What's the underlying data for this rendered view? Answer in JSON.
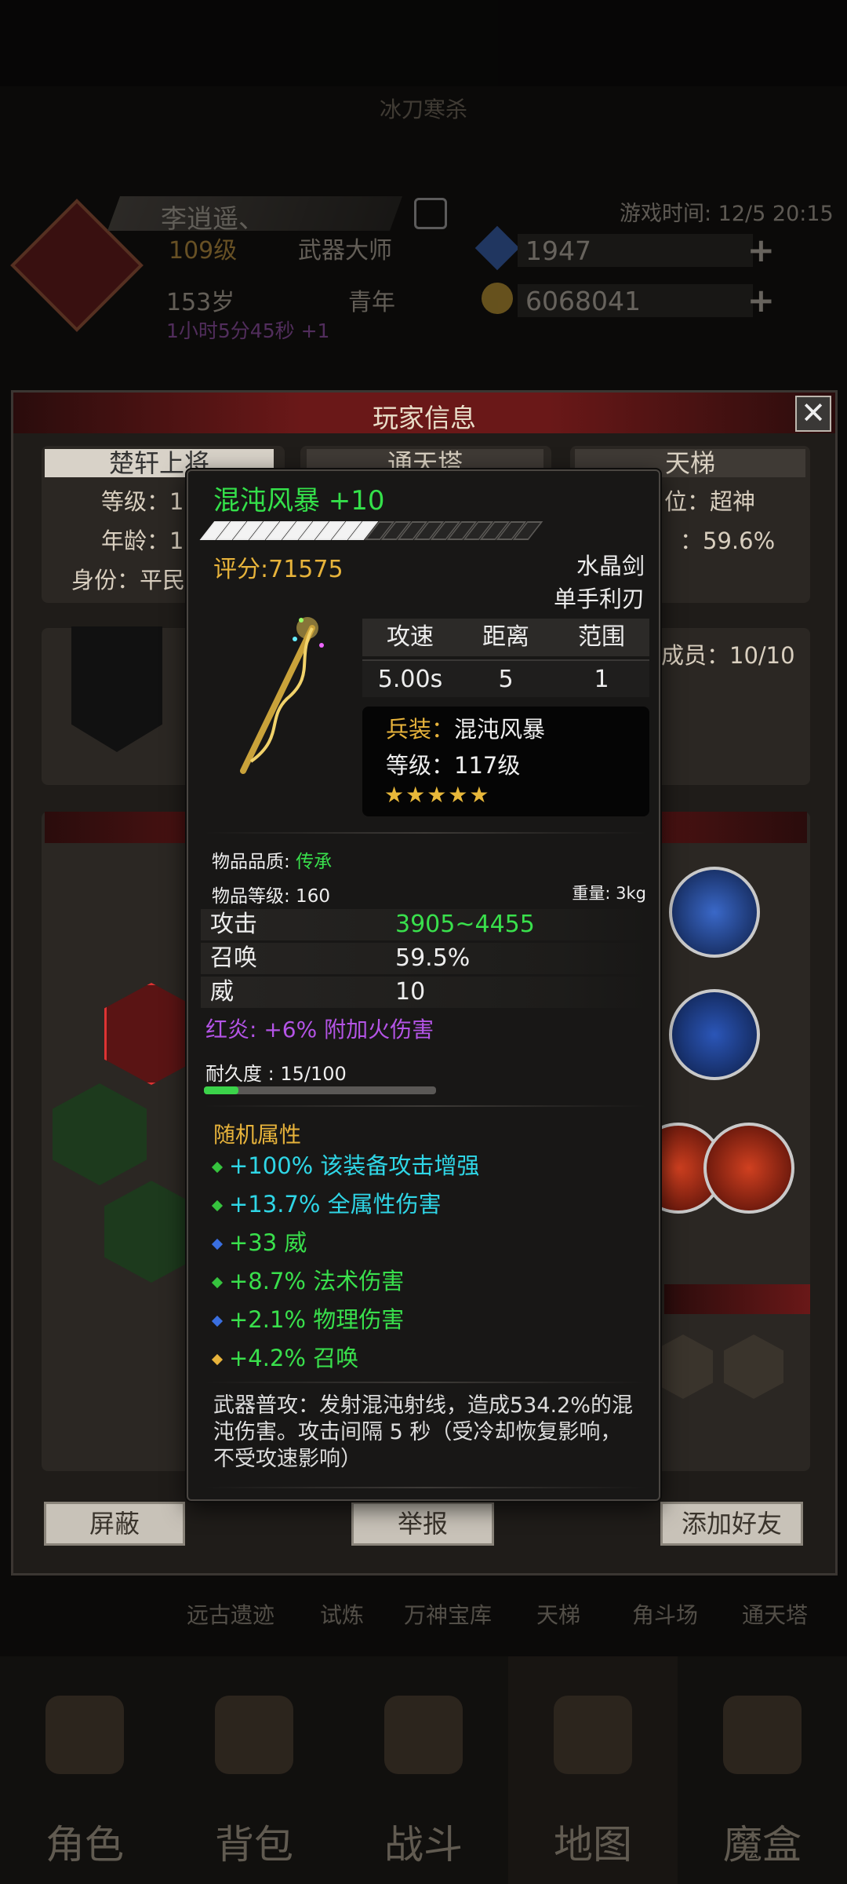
{
  "background": {
    "header_title": "冰刀寒杀",
    "player": {
      "name": "李逍遥、",
      "level": "109级",
      "class": "武器大师",
      "age": "153岁",
      "age_stage": "青年",
      "timer": "1小时5分45秒 +1"
    },
    "game_time": "游戏时间: 12/5 20:15",
    "resources": [
      {
        "icon": "blue-gem-icon",
        "value": "1947"
      },
      {
        "icon": "gold-coin-icon",
        "value": "6068041"
      }
    ],
    "nav_links": [
      "远古遗迹",
      "试炼",
      "万神宝库",
      "天梯",
      "角斗场",
      "通天塔"
    ],
    "tabs": [
      {
        "label": "角色",
        "icon": "helmet-icon"
      },
      {
        "label": "背包",
        "icon": "backpack-icon"
      },
      {
        "label": "战斗",
        "icon": "sword-shield-icon"
      },
      {
        "label": "地图",
        "icon": "scroll-map-icon",
        "active": true
      },
      {
        "label": "魔盒",
        "icon": "magic-box-icon"
      }
    ]
  },
  "dialog": {
    "title": "玩家信息",
    "tabs": [
      "楚轩上将",
      "通天塔",
      "天梯"
    ],
    "left_info": [
      "等级：1",
      "年龄：1",
      "身份：平民"
    ],
    "right_info": [
      "位：超神",
      "：59.6%"
    ],
    "guild_members": "成员：10/10",
    "buttons": {
      "block": "屏蔽",
      "report": "举报",
      "add_friend": "添加好友"
    }
  },
  "tooltip": {
    "name": "混沌风暴 +10",
    "name_color": "#34e04a",
    "enhance_level": 10,
    "enhance_max": 20,
    "score": "评分:71575",
    "weapon_type": "水晶剑",
    "weapon_sub": "单手利刃",
    "stat_headers": [
      "攻速",
      "距离",
      "范围"
    ],
    "stat_values": [
      "5.00s",
      "5",
      "1"
    ],
    "gear": {
      "key": "兵装：",
      "value": "混沌风暴",
      "level": "等级：117级",
      "stars": "★★★★★"
    },
    "quality_label": "物品品质: ",
    "quality_value": "传承",
    "item_level": "物品等级: 160",
    "weight": "重量:  3kg",
    "attributes": [
      {
        "k": "攻击",
        "v": "3905~4455",
        "color": "#39e04c"
      },
      {
        "k": "召唤",
        "v": "59.5%",
        "color": "#eeeeee"
      },
      {
        "k": "威",
        "v": "10",
        "color": "#eeeeee"
      }
    ],
    "special": "红炎: +6% 附加火伤害",
    "durability_label": "耐久度 : 15/100",
    "durability": 0.15,
    "random_title": "随机属性",
    "random_attrs": [
      {
        "text": "+100% 该装备攻击增强",
        "color": "#2fd6e6",
        "dot": "#36c33e"
      },
      {
        "text": "+13.7% 全属性伤害",
        "color": "#2fd6e6",
        "dot": "#36c33e"
      },
      {
        "text": "+33 威",
        "color": "#39e04c",
        "dot": "#3a6fe0"
      },
      {
        "text": "+8.7% 法术伤害",
        "color": "#39e04c",
        "dot": "#36c33e"
      },
      {
        "text": "+2.1% 物理伤害",
        "color": "#39e04c",
        "dot": "#3a6fe0"
      },
      {
        "text": "+4.2% 召唤",
        "color": "#39e04c",
        "dot": "#e7b33b"
      }
    ],
    "description": "武器普攻：发射混沌射线，造成534.2%的混沌伤害。攻击间隔 5 秒（受冷却恢复影响，不受攻速影响）"
  }
}
